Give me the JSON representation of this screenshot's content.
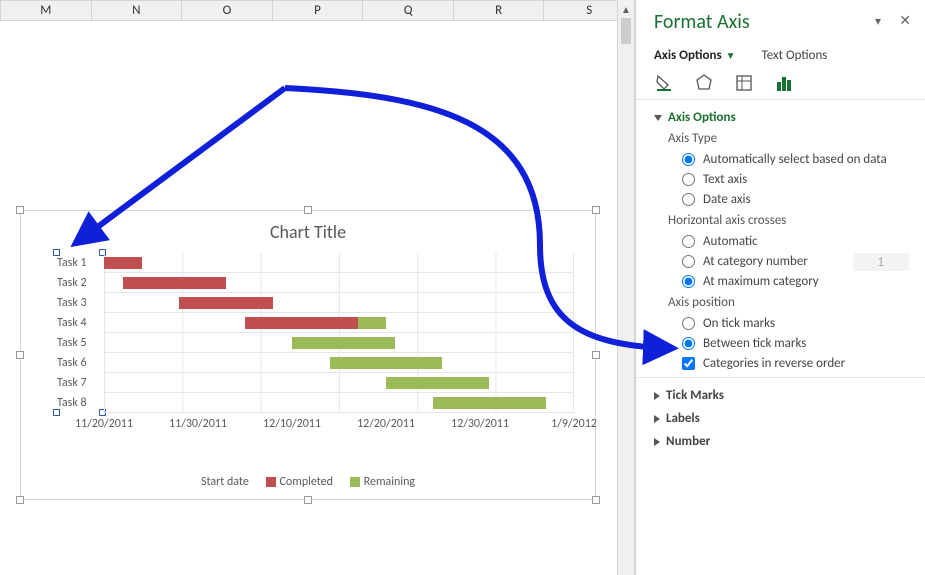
{
  "columns": [
    "M",
    "N",
    "O",
    "P",
    "Q",
    "R",
    "S"
  ],
  "chart": {
    "title": "Chart Title",
    "xaxis_title": "Start date",
    "legend_completed": "Completed",
    "legend_remaining": "Remaining"
  },
  "chart_data": {
    "type": "bar",
    "orientation": "horizontal-stacked",
    "categories": [
      "Task 1",
      "Task 2",
      "Task 3",
      "Task 4",
      "Task 5",
      "Task 6",
      "Task 7",
      "Task 8"
    ],
    "x_ticks": [
      "11/20/2011",
      "11/30/2011",
      "12/10/2011",
      "12/20/2011",
      "12/30/2011",
      "1/9/2012"
    ],
    "x_range_days": [
      0,
      50
    ],
    "series": [
      {
        "name": "Start date",
        "role": "offset",
        "values": [
          0,
          2,
          8,
          15,
          20,
          24,
          30,
          35
        ]
      },
      {
        "name": "Completed",
        "color": "#c05050",
        "values": [
          4,
          11,
          10,
          12,
          0,
          0,
          0,
          0
        ]
      },
      {
        "name": "Remaining",
        "color": "#9bbb59",
        "values": [
          0,
          0,
          0,
          3,
          11,
          12,
          11,
          12
        ]
      }
    ]
  },
  "pane": {
    "title": "Format Axis",
    "tab_axis": "Axis Options",
    "tab_text": "Text Options",
    "sec_axis_options": "Axis Options",
    "sec_tick_marks": "Tick Marks",
    "sec_labels": "Labels",
    "sec_number": "Number",
    "lbl_axis_type": "Axis Type",
    "opt_auto": "Automatically select based on data",
    "opt_text_axis": "Text axis",
    "opt_date_axis": "Date axis",
    "lbl_hcross": "Horizontal axis crosses",
    "opt_hcross_auto": "Automatic",
    "opt_hcross_catnum": "At category number",
    "catnum_value": "1",
    "opt_hcross_max": "At maximum category",
    "lbl_axis_pos": "Axis position",
    "opt_on_tick": "On tick marks",
    "opt_between_tick": "Between tick marks",
    "opt_reverse": "Categories in reverse order"
  }
}
